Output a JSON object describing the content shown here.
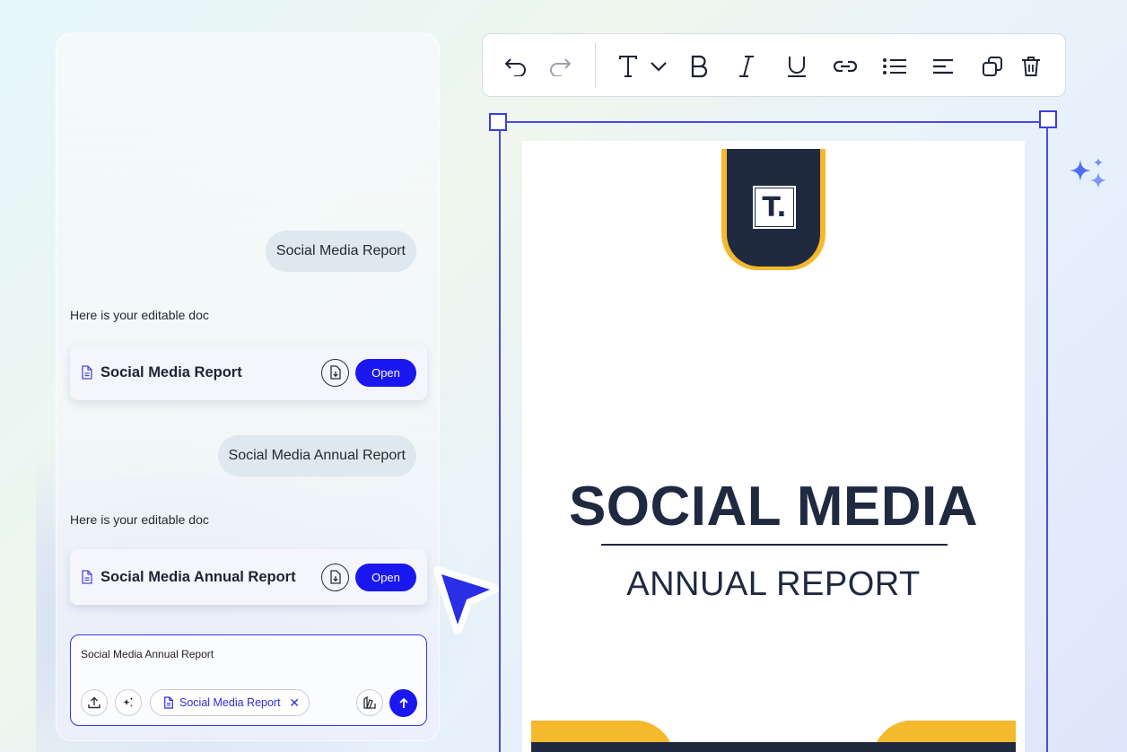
{
  "chat": {
    "messages": [
      {
        "role": "user",
        "text": "Social Media Report"
      },
      {
        "role": "assistant",
        "text": "Here is your editable doc",
        "card_title": "Social Media Report",
        "open_label": "Open",
        "card_icon": "file-text-icon",
        "download_icon": "file-download-icon"
      },
      {
        "role": "user",
        "text": "Social Media Annual Report"
      },
      {
        "role": "assistant",
        "text": "Here is your editable doc",
        "card_title": "Social Media Annual Report",
        "open_label": "Open",
        "card_icon": "file-text-icon",
        "download_icon": "file-download-icon"
      }
    ],
    "composer": {
      "value": "Social Media Annual Report",
      "attachment_label": "Social Media Report",
      "icons": [
        "upload-icon",
        "magic-sparkle-icon",
        "file-text-icon",
        "close-icon",
        "brand-kit-icon",
        "arrow-up-icon"
      ]
    }
  },
  "toolbar": {
    "tools": [
      "undo-icon",
      "redo-icon",
      "text-style-icon",
      "chevron-down-icon",
      "bold-icon",
      "italic-icon",
      "underline-icon",
      "link-icon",
      "bulleted-list-icon",
      "align-left-icon",
      "duplicate-icon",
      "delete-icon"
    ]
  },
  "document": {
    "logo_letter": "T.",
    "title": "SOCIAL MEDIA",
    "subtitle": "ANNUAL REPORT"
  },
  "colors": {
    "primary": "#1a17f0",
    "navy": "#1f2940",
    "accent_yellow": "#f4b92c",
    "selection": "#4a4be8"
  }
}
